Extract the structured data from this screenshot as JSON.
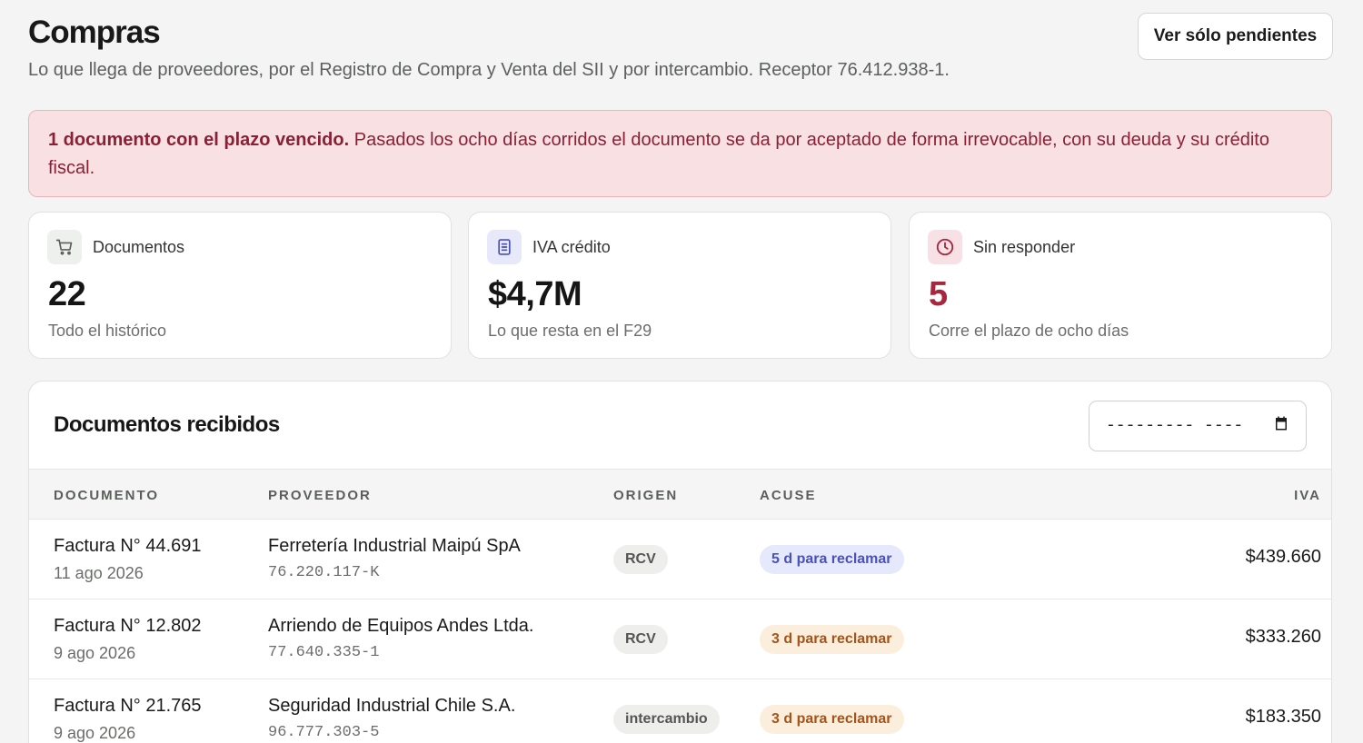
{
  "header": {
    "title": "Compras",
    "subtitle": "Lo que llega de proveedores, por el Registro de Compra y Venta del SII y por intercambio. Receptor 76.412.938-1.",
    "pending_button": "Ver sólo pendientes"
  },
  "alert": {
    "strong": "1 documento con el plazo vencido.",
    "text": " Pasados los ocho días corridos el documento se da por aceptado de forma irrevocable, con su deuda y su crédito fiscal."
  },
  "stats": [
    {
      "icon": "cart-icon",
      "label": "Documentos",
      "value": "22",
      "note": "Todo el histórico",
      "icon_bg": "#eef0ee",
      "value_color": "#151515"
    },
    {
      "icon": "document-icon",
      "label": "IVA crédito",
      "value": "$4,7M",
      "note": "Lo que resta en el F29",
      "icon_bg": "#e7e9fa",
      "value_color": "#151515"
    },
    {
      "icon": "clock-icon",
      "label": "Sin responder",
      "value": "5",
      "note": "Corre el plazo de ocho días",
      "icon_bg": "#f8e1e5",
      "value_color": "#a5283e"
    }
  ],
  "table": {
    "title": "Documentos recibidos",
    "date_placeholder": "--------- ----",
    "columns": [
      "DOCUMENTO",
      "PROVEEDOR",
      "ORIGEN",
      "ACUSE",
      "IVA"
    ],
    "rows": [
      {
        "doc": "Factura N° 44.691",
        "date": "11 ago 2026",
        "provider": "Ferretería Industrial Maipú SpA",
        "rut": "76.220.117-K",
        "origin": "RCV",
        "acuse": "5 d para reclamar",
        "acuse_style": "blue",
        "iva": "$439.660"
      },
      {
        "doc": "Factura N° 12.802",
        "date": "9 ago 2026",
        "provider": "Arriendo de Equipos Andes Ltda.",
        "rut": "77.640.335-1",
        "origin": "RCV",
        "acuse": "3 d para reclamar",
        "acuse_style": "amber",
        "iva": "$333.260"
      },
      {
        "doc": "Factura N° 21.765",
        "date": "9 ago 2026",
        "provider": "Seguridad Industrial Chile S.A.",
        "rut": "96.777.303-5",
        "origin": "intercambio",
        "acuse": "3 d para reclamar",
        "acuse_style": "amber",
        "iva": "$183.350"
      }
    ]
  }
}
